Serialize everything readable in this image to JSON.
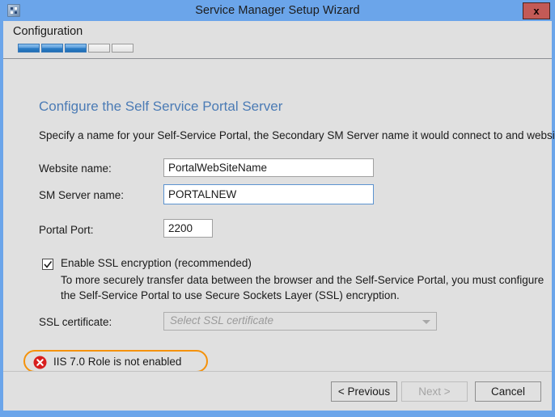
{
  "window": {
    "title": "Service Manager Setup Wizard",
    "app_icon": "setup-wizard-icon",
    "close_label": "x"
  },
  "header": {
    "step_label": "Configuration",
    "progress": {
      "total_segments": 5,
      "completed_segments": 3
    }
  },
  "content": {
    "heading": "Configure the Self Service Portal Server",
    "subtext": "Specify a name for your Self-Service Portal, the Secondary SM Server name it would connect to and website port",
    "fields": [
      {
        "label": "Website name:",
        "value": "PortalWebSiteName",
        "placeholder": "",
        "focused": false
      },
      {
        "label": "SM Server name:",
        "value": "PORTALNEW",
        "placeholder": "",
        "focused": true
      },
      {
        "label": "Portal Port:",
        "value": "2200",
        "placeholder": "",
        "focused": false
      }
    ],
    "ssl_checkbox": {
      "label": "Enable SSL encryption (recommended)",
      "checked": true,
      "description": "To more securely transfer data between the browser and the Self-Service Portal, you must configure the Self-Service Portal to use Secure Sockets Layer (SSL) encryption."
    },
    "ssl_certificate": {
      "label": "SSL certificate:",
      "placeholder": "Select SSL certificate",
      "selected_value": "",
      "disabled": true
    },
    "error": {
      "icon": "error-circle-icon",
      "message": "IIS 7.0 Role is not enabled"
    }
  },
  "footer": {
    "previous_label": "< Previous",
    "next_label": "Next >",
    "cancel_label": "Cancel",
    "next_disabled": true
  },
  "colors": {
    "titlebar": "#6ba5ea",
    "close_button": "#c35a56",
    "heading_blue": "#4b7bb5",
    "progress_fill": "#2e7fc7",
    "error_border": "#f5920b",
    "error_icon": "#d81e1e",
    "focus_border": "#5c93d0",
    "client_background": "#e0e0e0"
  }
}
